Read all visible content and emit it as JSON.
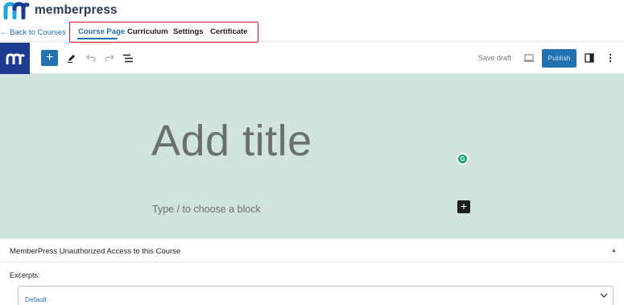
{
  "header": {
    "brand": "memberpress",
    "back_link": "← Back to Courses",
    "tabs": [
      {
        "label": "Course Page",
        "active": true
      },
      {
        "label": "Curriculum",
        "active": false
      },
      {
        "label": "Settings",
        "active": false
      },
      {
        "label": "Certificate",
        "active": false
      }
    ]
  },
  "toolbar": {
    "site_icon": "memberpress-m-icon",
    "add_block": "+",
    "icons": [
      "pen-tool-icon",
      "undo-icon",
      "redo-icon",
      "list-view-icon"
    ],
    "save_draft": "Save draft",
    "publish": "Publish",
    "preview_icon": "desktop-preview-icon",
    "settings_icon": "sidebar-toggle-icon",
    "options_icon": "more-vertical-icon"
  },
  "canvas": {
    "title_placeholder": "Add title",
    "block_placeholder": "Type / to choose a block",
    "grammarly_letter": "G",
    "block_add": "+"
  },
  "meta_box": {
    "title": "MemberPress Unauthorized Access to this Course",
    "toggle": "▲",
    "excerpts_label": "Excerpts:",
    "excerpts_value": "Default"
  },
  "colors": {
    "accent": "#2271b1",
    "highlight_box": "#e0141c",
    "canvas_bg": "#d1e3de",
    "brand_dark": "#1d3b8f"
  }
}
